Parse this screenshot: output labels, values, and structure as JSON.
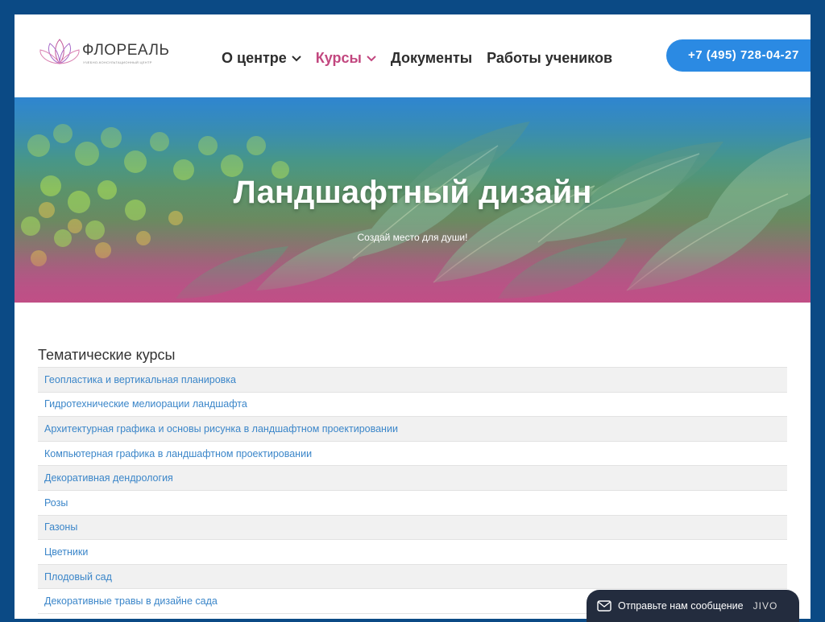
{
  "header": {
    "logo": {
      "name": "ФЛОРЕАЛЬ",
      "tagline": "УЧЕБНО-КОНСУЛЬТАЦИОННЫЙ ЦЕНТР",
      "icon": "lotus-logo-icon"
    },
    "nav": [
      {
        "label": "О центре",
        "dropdown": true,
        "active": false
      },
      {
        "label": "Курсы",
        "dropdown": true,
        "active": true
      },
      {
        "label": "Документы",
        "dropdown": false,
        "active": false
      },
      {
        "label": "Работы учеников",
        "dropdown": false,
        "active": false
      }
    ],
    "phone": "+7 (495) 728-04-27"
  },
  "hero": {
    "title": "Ландшафтный дизайн",
    "subtitle": "Создай место для души!"
  },
  "courses": {
    "title": "Тематические курсы",
    "items": [
      "Геопластика и вертикальная планировка",
      "Гидротехнические мелиорации ландшафта",
      "Архитектурная графика и основы рисунка в ландшафтном проектировании",
      "Компьютерная графика в ландшафтном проектировании",
      "Декоративная дендрология",
      "Розы",
      "Газоны",
      "Цветники",
      "Плодовый сад",
      "Декоративные травы в дизайне сада"
    ]
  },
  "chat": {
    "label": "Отправьте нам сообщение",
    "brand": "JIVO",
    "icon": "envelope-icon"
  },
  "colors": {
    "frame": "#0b4a85",
    "accent_pink": "#c2477f",
    "phone_button": "#2b8ae3",
    "link": "#3b86c9",
    "chat_bg": "#232c3e"
  }
}
